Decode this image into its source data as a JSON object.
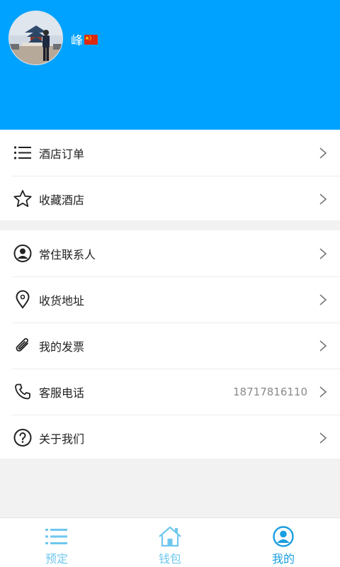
{
  "profile": {
    "username": "峰",
    "flag": "china-flag-icon"
  },
  "menu_group_1": [
    {
      "label": "酒店订单",
      "icon": "list-icon"
    },
    {
      "label": "收藏酒店",
      "icon": "star-icon"
    }
  ],
  "menu_group_2": [
    {
      "label": "常住联系人",
      "icon": "user-circle-icon"
    },
    {
      "label": "收货地址",
      "icon": "location-pin-icon"
    },
    {
      "label": "我的发票",
      "icon": "paperclip-icon"
    },
    {
      "label": "客服电话",
      "icon": "phone-icon",
      "value": "18717816110"
    },
    {
      "label": "关于我们",
      "icon": "question-circle-icon"
    }
  ],
  "tabbar": {
    "items": [
      {
        "label": "预定",
        "icon": "list-icon"
      },
      {
        "label": "钱包",
        "icon": "house-icon"
      },
      {
        "label": "我的",
        "icon": "user-circle-icon",
        "active": true
      }
    ]
  },
  "colors": {
    "header": "#00a2ff",
    "tab_inactive": "#6fc7ee",
    "tab_active": "#1a9ee0"
  }
}
